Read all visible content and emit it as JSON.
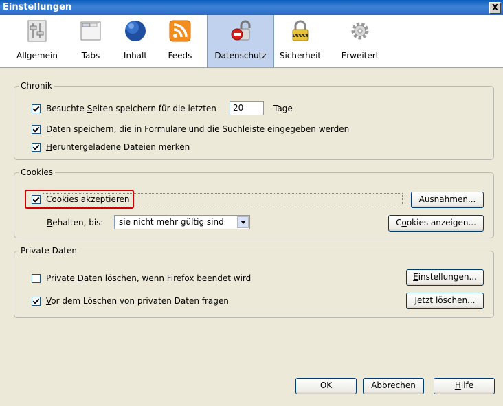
{
  "window": {
    "title": "Einstellungen",
    "close_label": "X"
  },
  "toolbar": {
    "items": [
      {
        "label": "Allgemein",
        "icon": "switch-panel-icon"
      },
      {
        "label": "Tabs",
        "icon": "tabs-window-icon"
      },
      {
        "label": "Inhalt",
        "icon": "globe-icon"
      },
      {
        "label": "Feeds",
        "icon": "rss-feed-icon"
      },
      {
        "label": "Datenschutz",
        "icon": "privacy-lock-icon"
      },
      {
        "label": "Sicherheit",
        "icon": "padlock-icon"
      },
      {
        "label": "Erweitert",
        "icon": "gear-icon"
      }
    ],
    "active": "Datenschutz"
  },
  "chronik": {
    "legend": "Chronik",
    "history_pre": "Besuchte ",
    "history_u": "S",
    "history_post": "eiten speichern für die letzten",
    "history_days_value": "20",
    "history_days_unit": "Tage",
    "forms_u": "D",
    "forms_post": "aten speichern, die in Formulare und die Suchleiste eingegeben werden",
    "downloads_u": "H",
    "downloads_post": "eruntergeladene Dateien merken"
  },
  "cookies": {
    "legend": "Cookies",
    "accept_u": "C",
    "accept_post": "ookies akzeptieren",
    "exceptions_u": "A",
    "exceptions_post": "usnahmen...",
    "keep_u": "B",
    "keep_post": "ehalten, bis:",
    "keep_value": "sie nicht mehr gültig sind",
    "show_pre": "C",
    "show_u": "o",
    "show_post": "okies anzeigen..."
  },
  "private": {
    "legend": "Private Daten",
    "clear_pre": "Private ",
    "clear_u": "D",
    "clear_post": "aten löschen, wenn Firefox beendet wird",
    "settings_u": "E",
    "settings_post": "instellungen...",
    "ask_u": "V",
    "ask_post": "or dem Löschen von privaten Daten fragen",
    "clear_now_u": "J",
    "clear_now_post": "etzt löschen..."
  },
  "footer": {
    "ok": "OK",
    "cancel": "Abbrechen",
    "help_u": "H",
    "help_post": "ilfe"
  }
}
